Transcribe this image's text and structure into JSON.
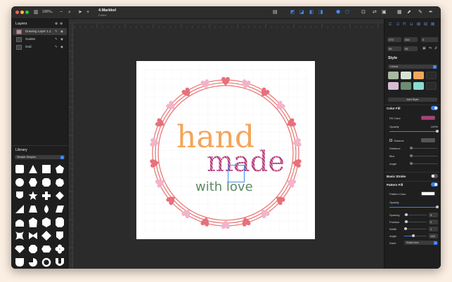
{
  "titlebar": {
    "zoom": "100%",
    "file_name": "4.Markkel",
    "file_status": "Edited"
  },
  "layers": {
    "title": "Layers",
    "items": [
      {
        "label": "Drawing Layer 1.1",
        "selected": true
      },
      {
        "label": "Guides",
        "selected": false
      },
      {
        "label": "Grid",
        "selected": false
      }
    ]
  },
  "library": {
    "title": "Library",
    "selected": "Simple Shapes"
  },
  "artwork": {
    "line1": "hand",
    "line2": "made",
    "line3": "with love"
  },
  "inspector": {
    "x": "473",
    "y": "454",
    "rotation": "0",
    "w": "59",
    "h": "95"
  },
  "style": {
    "title": "Style",
    "selected": "Linear",
    "add_label": "Add Style",
    "swatches": [
      "#a9b8a0",
      "#d6e2d5",
      "#f1a65c",
      "#2b2b2b",
      "#d6bcd4",
      "#6b8c73",
      "#89dcd2",
      "#2b2b2b"
    ]
  },
  "color_fill": {
    "title": "Color Fill",
    "enabled": true,
    "fill_color_label": "Fill Color",
    "fill_color": "#b53a7a",
    "opacity_label": "Opacity",
    "opacity_value": "100%",
    "opacity": 1.0,
    "shadow_label": "Shadow",
    "shadow_checked": false,
    "distance_label": "Distance",
    "blur_label": "Blur",
    "angle_label": "Angle"
  },
  "basic_stroke": {
    "title": "Basic Stroke",
    "enabled": false
  },
  "pattern_fill": {
    "title": "Pattern Fill",
    "enabled": true,
    "pattern_color_label": "Pattern Color",
    "pattern_color": "#ffffff",
    "opacity_label": "Opacity",
    "opacity": 1.0,
    "spacing_label": "Spacing",
    "spacing_value": "5",
    "spacing": 0.08,
    "position_label": "Position",
    "position_value": "0",
    "position": 0.1,
    "width_label": "Width",
    "width_value": "1",
    "width": 0.05,
    "angle_label": "Angle",
    "angle_value": "145",
    "angle": 0.4,
    "dash_label": "Dash",
    "dash_value": "Solid Line"
  },
  "icons": [
    "sidebar-toggle-icon",
    "zoom-icon",
    "pointer-icon",
    "add-icon",
    "align-icon",
    "boolean-union-icon",
    "boolean-subtract-icon",
    "boolean-intersect-icon",
    "boolean-exclude-icon",
    "group-icon",
    "ungroup-icon",
    "crop-icon",
    "flip-icon",
    "lock-icon",
    "image-icon",
    "share-icon",
    "brush-icon",
    "pen-icon",
    "layers-icon",
    "eye-icon"
  ]
}
